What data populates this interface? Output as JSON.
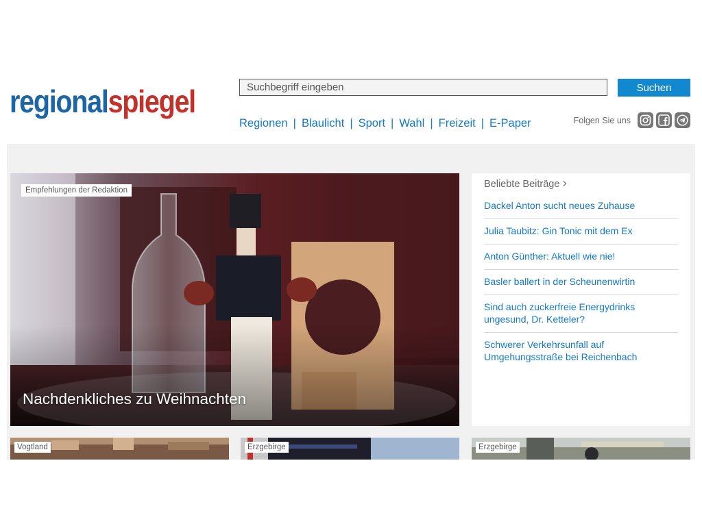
{
  "header": {
    "logo_part1": "regional",
    "logo_part2": "spiegel",
    "search_placeholder": "Suchbegriff eingeben",
    "search_button": "Suchen",
    "nav": [
      "Regionen",
      "Blaulicht",
      "Sport",
      "Wahl",
      "Freizeit",
      "E-Paper"
    ],
    "nav_separator": "|",
    "follow_label": "Folgen Sie uns",
    "social_icons": [
      "instagram-icon",
      "facebook-icon",
      "telegram-icon"
    ]
  },
  "hero": {
    "tag": "Empfehlungen der Redaktion",
    "title": "Nachdenkliches zu Weihnachten"
  },
  "popular": {
    "heading": "Beliebte Beiträge",
    "items": [
      "Dackel Anton sucht neues Zuhause",
      "Julia Taubitz: Gin Tonic mit dem Ex",
      "Anton Günther: Aktuell wie nie!",
      "Basler ballert in der Scheunenwirtin",
      "Sind auch zuckerfreie Energydrinks ungesund, Dr. Ketteler?",
      "Schwerer Verkehrsunfall auf Umgehungsstraße bei Reichenbach"
    ]
  },
  "cards": [
    {
      "tag": "Vogtland"
    },
    {
      "tag": "Erzgebirge"
    },
    {
      "tag": "Erzgebirge"
    }
  ],
  "colors": {
    "brand_blue": "#1d66a6",
    "brand_red": "#c2312a",
    "link_blue": "#1479c6",
    "button_blue": "#1188d0"
  }
}
